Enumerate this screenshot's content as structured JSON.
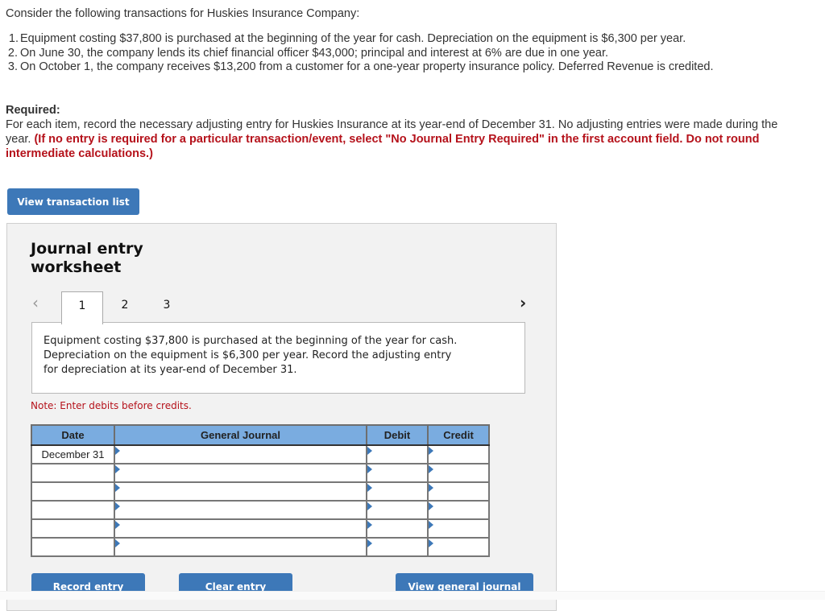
{
  "intro": "Consider the following transactions for Huskies Insurance Company:",
  "transactions": [
    {
      "num": "1.",
      "text": "Equipment costing $37,800 is purchased at the beginning of the year for cash. Depreciation on the equipment is $6,300 per year."
    },
    {
      "num": "2.",
      "text": "On June 30, the company lends its chief financial officer $43,000; principal and interest at 6% are due in one year."
    },
    {
      "num": "3.",
      "text": "On October 1, the company receives $13,200 from a customer for a one-year property insurance policy. Deferred Revenue is credited."
    }
  ],
  "required": {
    "title": "Required:",
    "text": "For each item, record the necessary adjusting entry for Huskies Insurance at its year-end of December 31. No adjusting entries were made during the year.",
    "instruction": "(If no entry is required for a particular transaction/event, select \"No Journal Entry Required\" in the first account field. Do not round intermediate calculations.)"
  },
  "buttons": {
    "view_transaction_list": "View transaction list",
    "record_entry": "Record entry",
    "clear_entry": "Clear entry",
    "view_general_journal": "View general journal"
  },
  "worksheet": {
    "title": "Journal entry worksheet",
    "prev_icon": "‹",
    "next_icon": "›",
    "tabs": [
      "1",
      "2",
      "3"
    ],
    "active_tab": "1",
    "description": "Equipment costing $37,800 is purchased at the beginning of the year for cash. Depreciation on the equipment is $6,300 per year. Record the adjusting entry for depreciation at its year-end of December 31.",
    "note": "Note: Enter debits before credits."
  },
  "journal": {
    "headers": {
      "date": "Date",
      "general_journal": "General Journal",
      "debit": "Debit",
      "credit": "Credit"
    },
    "rows": [
      {
        "date": "December 31",
        "account": "",
        "debit": "",
        "credit": ""
      },
      {
        "date": "",
        "account": "",
        "debit": "",
        "credit": ""
      },
      {
        "date": "",
        "account": "",
        "debit": "",
        "credit": ""
      },
      {
        "date": "",
        "account": "",
        "debit": "",
        "credit": ""
      },
      {
        "date": "",
        "account": "",
        "debit": "",
        "credit": ""
      },
      {
        "date": "",
        "account": "",
        "debit": "",
        "credit": ""
      }
    ]
  },
  "colors": {
    "accent": "#3d78b8",
    "header_blue": "#7aace0",
    "warning_red": "#b5121b",
    "panel_bg": "#f2f2f2"
  }
}
